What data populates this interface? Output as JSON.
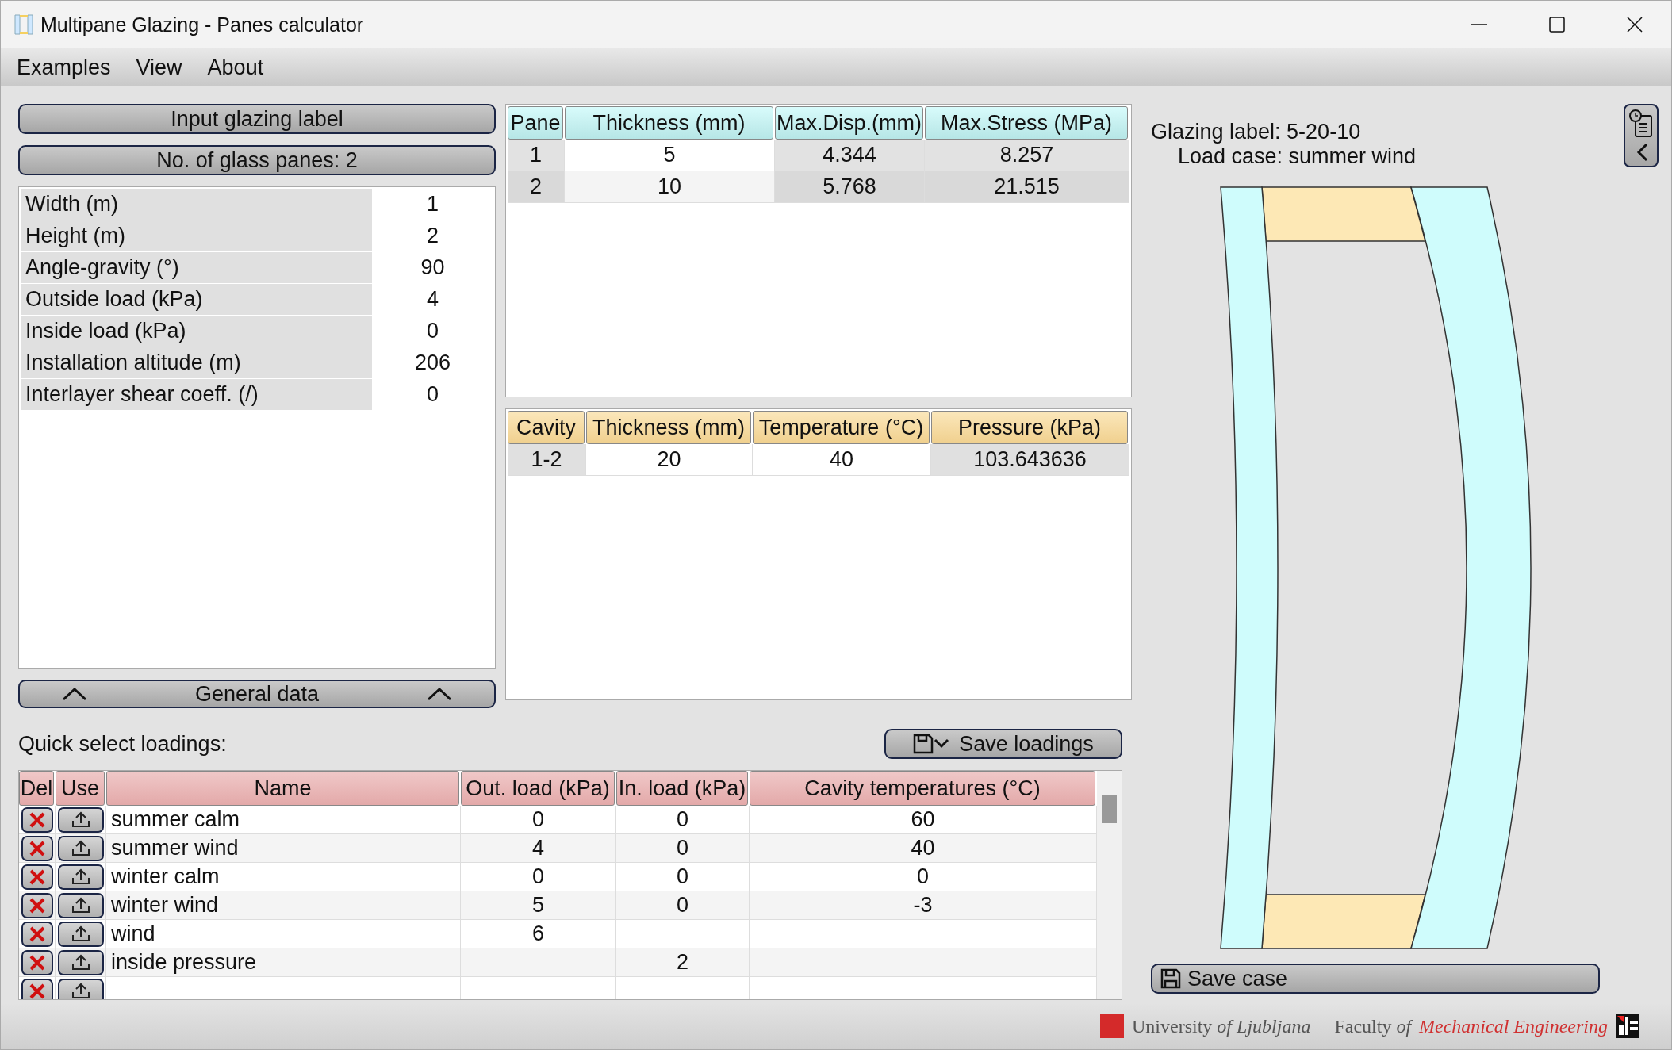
{
  "window": {
    "title": "Multipane Glazing - Panes calculator"
  },
  "menu": [
    "Examples",
    "View",
    "About"
  ],
  "left": {
    "label_button": "Input glazing label",
    "panes_button": "No. of glass panes: 2",
    "properties": [
      {
        "label": "Width (m)",
        "value": "1"
      },
      {
        "label": "Height (m)",
        "value": "2"
      },
      {
        "label": "Angle-gravity (°)",
        "value": "90"
      },
      {
        "label": "Outside load (kPa)",
        "value": "4"
      },
      {
        "label": "Inside load (kPa)",
        "value": "0"
      },
      {
        "label": "Installation altitude (m)",
        "value": "206"
      },
      {
        "label": "Interlayer shear coeff. (/)",
        "value": "0"
      }
    ],
    "general_button": "General data"
  },
  "panes_table": {
    "columns": [
      "Pane",
      "Thickness (mm)",
      "Max.Disp.(mm)",
      "Max.Stress (MPa)"
    ],
    "rows": [
      [
        "1",
        "5",
        "4.344",
        "8.257"
      ],
      [
        "2",
        "10",
        "5.768",
        "21.515"
      ]
    ]
  },
  "cavities_table": {
    "columns": [
      "Cavity",
      "Thickness (mm)",
      "Temperature (°C)",
      "Pressure (kPa)"
    ],
    "rows": [
      [
        "1-2",
        "20",
        "40",
        "103.643636"
      ]
    ]
  },
  "quick_select": {
    "label": "Quick select loadings:",
    "save_button": "Save loadings",
    "columns": [
      "Del",
      "Use",
      "Name",
      "Out. load (kPa)",
      "In. load (kPa)",
      "Cavity temperatures (°C)"
    ],
    "rows": [
      {
        "name": "summer calm",
        "out": "0",
        "in": "0",
        "temps": "60"
      },
      {
        "name": "summer wind",
        "out": "4",
        "in": "0",
        "temps": "40"
      },
      {
        "name": "winter calm",
        "out": "0",
        "in": "0",
        "temps": "0"
      },
      {
        "name": "winter wind",
        "out": "5",
        "in": "0",
        "temps": "-3"
      },
      {
        "name": "wind",
        "out": "6"
      },
      {
        "name": "inside pressure",
        "in": "2"
      },
      {}
    ]
  },
  "preview": {
    "glazing_label": "Glazing label: 5-20-10",
    "load_case": "Load case: summer wind",
    "save_button": "Save case"
  },
  "footer": {
    "university": "University *of Ljubljana*",
    "faculty": "Faculty *of*",
    "department": "Mechanical Engineering"
  }
}
